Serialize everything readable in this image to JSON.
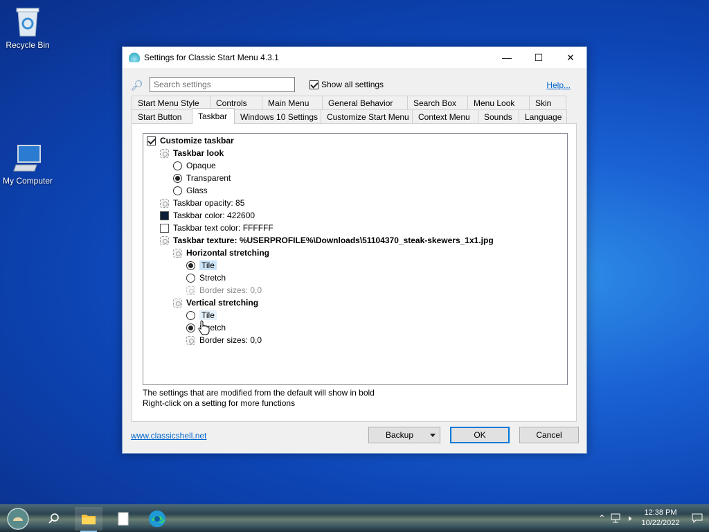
{
  "desktop": {
    "icons": [
      {
        "label": "Recycle Bin",
        "icon": "recycle-bin-icon"
      },
      {
        "label": "My Computer",
        "icon": "computer-icon"
      }
    ]
  },
  "window": {
    "title": "Settings for Classic Start Menu 4.3.1",
    "controls": {
      "minimize": "—",
      "maximize": "☐",
      "close": "✕"
    }
  },
  "search": {
    "placeholder": "Search settings",
    "show_all_label": "Show all settings",
    "show_all_checked": true,
    "help_label": "Help..."
  },
  "tabs": {
    "row1": [
      "Start Menu Style",
      "Controls",
      "Main Menu",
      "General Behavior",
      "Search Box",
      "Menu Look",
      "Skin"
    ],
    "row2": [
      "Start Button",
      "Taskbar",
      "Windows 10 Settings",
      "Customize Start Menu",
      "Context Menu",
      "Sounds",
      "Language"
    ],
    "active": "Taskbar"
  },
  "tree": [
    {
      "label": "Customize taskbar",
      "type": "checkbox",
      "checked": true,
      "bold": true,
      "level": 0
    },
    {
      "label": "Taskbar look",
      "type": "gear",
      "bold": true,
      "level": 1
    },
    {
      "label": "Opaque",
      "type": "radio",
      "checked": false,
      "level": 2
    },
    {
      "label": "Transparent",
      "type": "radio",
      "checked": true,
      "level": 2
    },
    {
      "label": "Glass",
      "type": "radio",
      "checked": false,
      "level": 2
    },
    {
      "label": "Taskbar opacity: 85",
      "type": "gear",
      "level": 1
    },
    {
      "label": "Taskbar color: 422600",
      "type": "swatch",
      "color": "#0b1e35",
      "level": 1
    },
    {
      "label": "Taskbar text color: FFFFFF",
      "type": "swatch",
      "color": "#ffffff",
      "level": 1
    },
    {
      "label": "Taskbar texture: %USERPROFILE%\\Downloads\\51104370_steak-skewers_1x1.jpg",
      "type": "gear",
      "bold": true,
      "level": 1
    },
    {
      "label": "Horizontal stretching",
      "type": "gear",
      "bold": true,
      "level": 2
    },
    {
      "label": "Tile",
      "type": "radio",
      "checked": true,
      "selected": true,
      "level": 3
    },
    {
      "label": "Stretch",
      "type": "radio",
      "checked": false,
      "level": 3
    },
    {
      "label": "Border sizes: 0,0",
      "type": "gear",
      "disabled": true,
      "level": 3
    },
    {
      "label": "Vertical stretching",
      "type": "gear",
      "bold": true,
      "level": 2
    },
    {
      "label": "Tile",
      "type": "radio",
      "checked": false,
      "hover": true,
      "level": 3
    },
    {
      "label": "Stretch",
      "type": "radio",
      "checked": true,
      "level": 3
    },
    {
      "label": "Border sizes: 0,0",
      "type": "gear",
      "level": 3
    }
  ],
  "hints": [
    "The settings that are modified from the default will show in bold",
    "Right-click on a setting for more functions"
  ],
  "footer": {
    "link": "www.classicshell.net",
    "backup_label": "Backup",
    "ok_label": "OK",
    "cancel_label": "Cancel"
  },
  "taskbar": {
    "items": [
      "start-orb-icon",
      "search-icon",
      "file-explorer-icon",
      "notepad-icon",
      "edge-icon"
    ],
    "tray_icons": [
      "chevron-up-icon",
      "network-icon",
      "volume-icon"
    ],
    "time": "12:38 PM",
    "date": "10/22/2022",
    "notification_icon": "notification-icon"
  }
}
